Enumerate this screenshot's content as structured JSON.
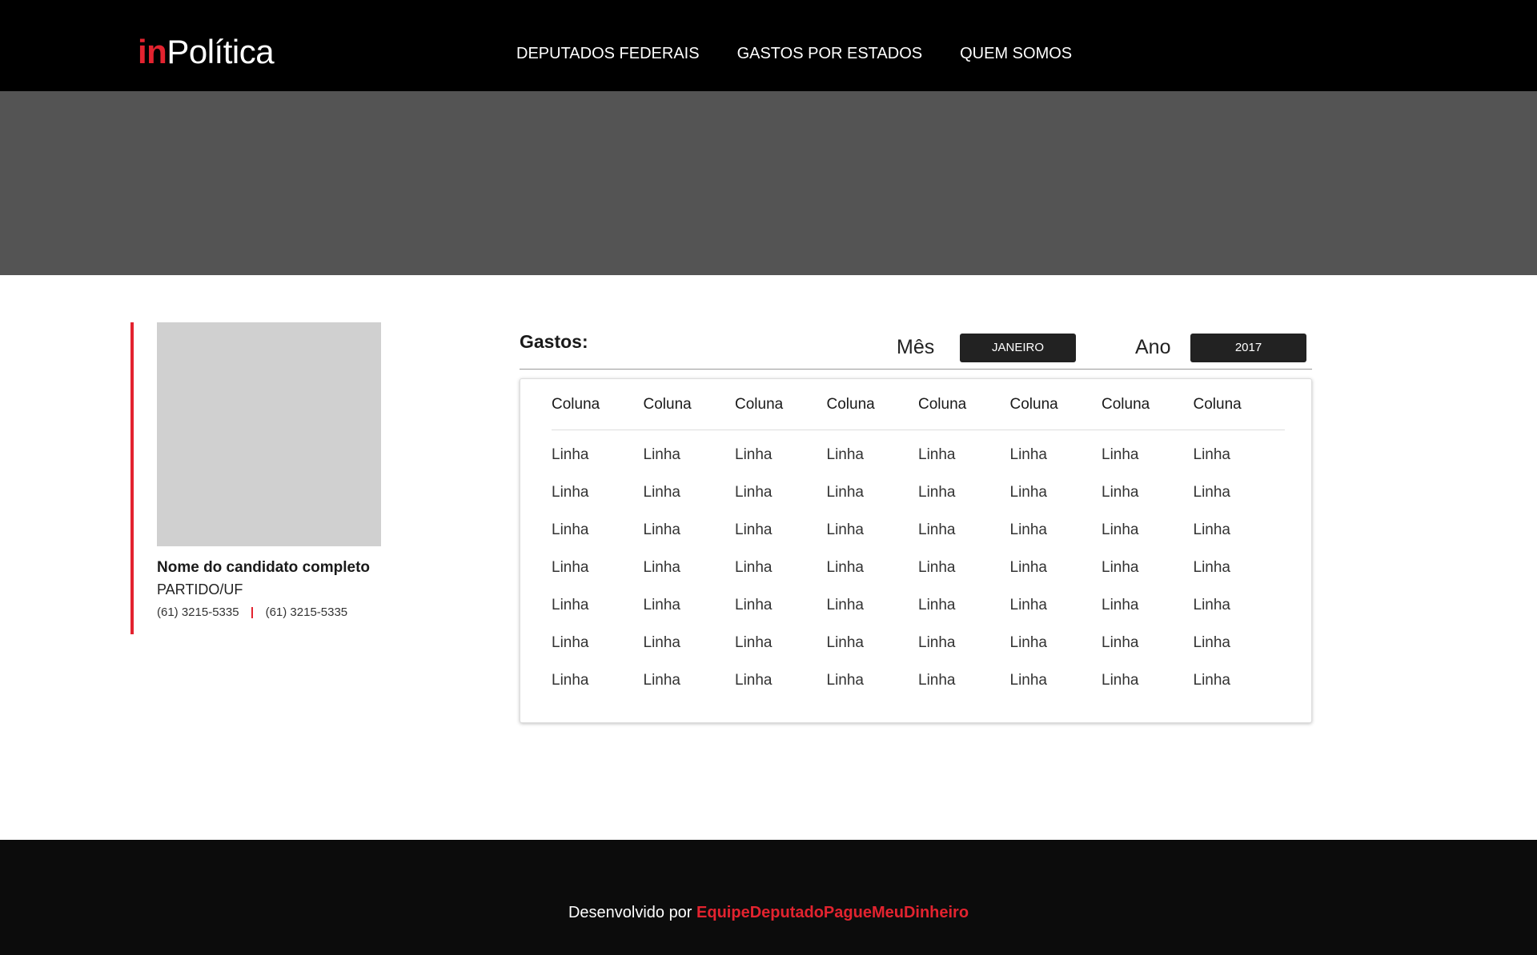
{
  "header": {
    "logo_prefix": "in",
    "logo_suffix": "Política",
    "nav": [
      "DEPUTADOS FEDERAIS",
      "GASTOS POR ESTADOS",
      "QUEM SOMOS"
    ]
  },
  "profile": {
    "name": "Nome do candidato completo",
    "party": "PARTIDO/UF",
    "phone1": "(61) 3215-5335",
    "phone2": "(61) 3215-5335"
  },
  "spending": {
    "title": "Gastos:",
    "month_label": "Mês",
    "month_value": "JANEIRO",
    "year_label": "Ano",
    "year_value": "2017",
    "columns": [
      "Coluna",
      "Coluna",
      "Coluna",
      "Coluna",
      "Coluna",
      "Coluna",
      "Coluna",
      "Coluna"
    ],
    "rows": [
      [
        "Linha",
        "Linha",
        "Linha",
        "Linha",
        "Linha",
        "Linha",
        "Linha",
        "Linha"
      ],
      [
        "Linha",
        "Linha",
        "Linha",
        "Linha",
        "Linha",
        "Linha",
        "Linha",
        "Linha"
      ],
      [
        "Linha",
        "Linha",
        "Linha",
        "Linha",
        "Linha",
        "Linha",
        "Linha",
        "Linha"
      ],
      [
        "Linha",
        "Linha",
        "Linha",
        "Linha",
        "Linha",
        "Linha",
        "Linha",
        "Linha"
      ],
      [
        "Linha",
        "Linha",
        "Linha",
        "Linha",
        "Linha",
        "Linha",
        "Linha",
        "Linha"
      ],
      [
        "Linha",
        "Linha",
        "Linha",
        "Linha",
        "Linha",
        "Linha",
        "Linha",
        "Linha"
      ],
      [
        "Linha",
        "Linha",
        "Linha",
        "Linha",
        "Linha",
        "Linha",
        "Linha",
        "Linha"
      ]
    ]
  },
  "footer": {
    "prefix": "Desenvolvido por",
    "team": "EquipeDeputadoPagueMeuDinheiro"
  },
  "colors": {
    "accent": "#e3232f",
    "header_bg": "#000000",
    "banner_bg": "#545454",
    "footer_bg": "#0c0c0c"
  }
}
